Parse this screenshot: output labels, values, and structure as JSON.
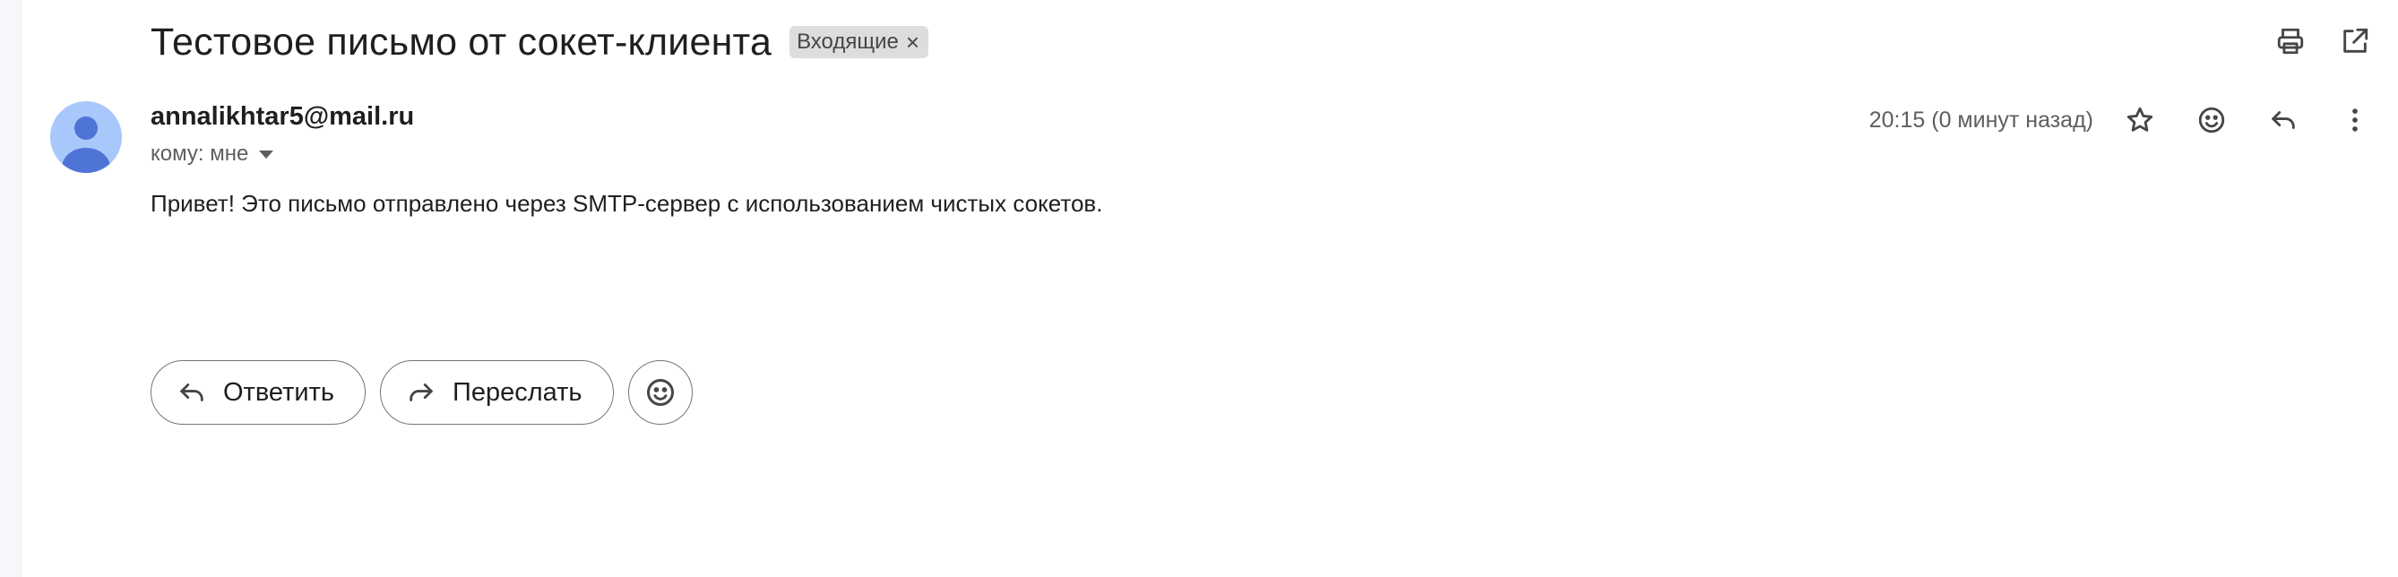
{
  "email": {
    "subject": "Тестовое письмо от сокет-клиента",
    "label": "Входящие",
    "label_remove": "×",
    "sender": "annalikhtar5@mail.ru",
    "recipient": "кому: мне",
    "timestamp": "20:15 (0 минут назад)",
    "body": "Привет! Это письмо отправлено через SMTP-сервер с использованием чистых сокетов."
  },
  "actions": {
    "reply_label": "Ответить",
    "forward_label": "Переслать"
  },
  "icons": {
    "top": [
      "print-icon",
      "open-in-new-window-icon"
    ],
    "header": [
      "star-icon",
      "emoji-icon",
      "reply-icon",
      "more-vert-icon"
    ],
    "bar": [
      "reply-icon",
      "forward-icon",
      "emoji-icon"
    ]
  },
  "colors": {
    "avatar_bg": "#a8c7fa",
    "avatar_fg": "#4e74d6",
    "chip_bg": "#dddddd",
    "text": "#1f1f1f",
    "secondary_text": "#5e5e5e",
    "icon": "#444746"
  }
}
